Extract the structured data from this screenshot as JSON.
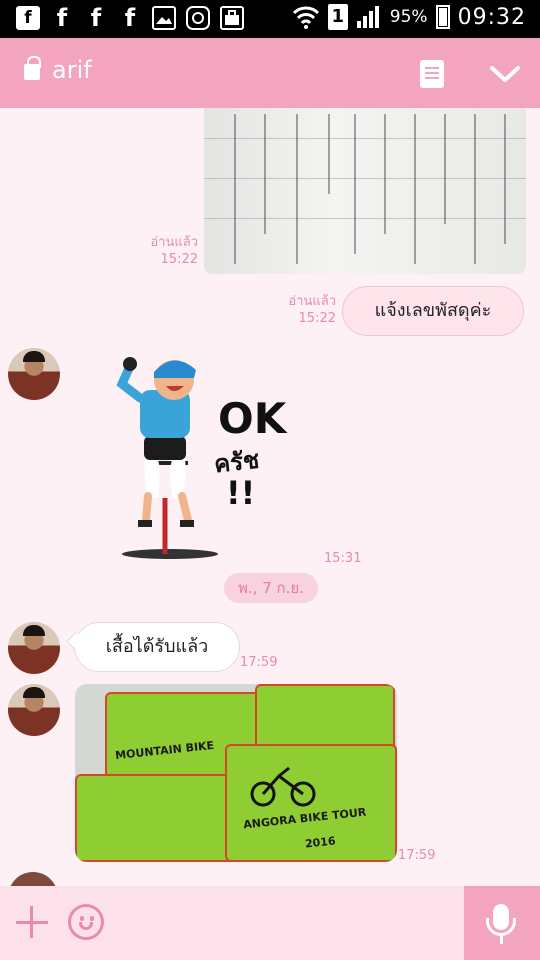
{
  "status_bar": {
    "left_icons": [
      "facebook-icon",
      "facebook-icon",
      "facebook-icon",
      "facebook-icon",
      "gallery-icon",
      "instagram-icon",
      "briefcase-icon"
    ],
    "fb_glyph": "f",
    "sim_slot": "1",
    "battery_percent": "95%",
    "battery_level": 0.95,
    "time": "09:32"
  },
  "header": {
    "title": "arif",
    "icons": [
      "lock-icon",
      "notes-icon",
      "check-icon"
    ]
  },
  "messages": [
    {
      "type": "image",
      "direction": "outgoing",
      "read_label": "อ่านแล้ว",
      "time": "15:22",
      "content": "receipt-photo"
    },
    {
      "type": "text",
      "direction": "outgoing",
      "read_label": "อ่านแล้ว",
      "time": "15:22",
      "text": "แจ้งเลขพัสดุค่ะ"
    },
    {
      "type": "sticker",
      "direction": "incoming",
      "time": "15:31",
      "sticker_text": "OK",
      "sticker_subtext": "ครัช",
      "sticker_exclaim": "!!"
    },
    {
      "type": "date_divider",
      "text": "พ., 7 ก.ย."
    },
    {
      "type": "text",
      "direction": "incoming",
      "time": "17:59",
      "text": "เสื้อได้รับแล้ว"
    },
    {
      "type": "image",
      "direction": "incoming",
      "time": "17:59",
      "content": "cycling-jerseys-photo"
    }
  ],
  "photo_text": {
    "jersey_tour": "ANGORA BIKE TOUR",
    "jersey_mtb": "MOUNTAIN BIKE",
    "jersey_year": "2016"
  },
  "input_bar": {
    "icons": [
      "plus-icon",
      "emoji-icon",
      "microphone-icon"
    ]
  },
  "colors": {
    "accent": "#f3a4be",
    "chat_background": "#fdf1f5",
    "read_text": "#e88aaa",
    "outgoing_bubble": "#ffe4ec"
  }
}
